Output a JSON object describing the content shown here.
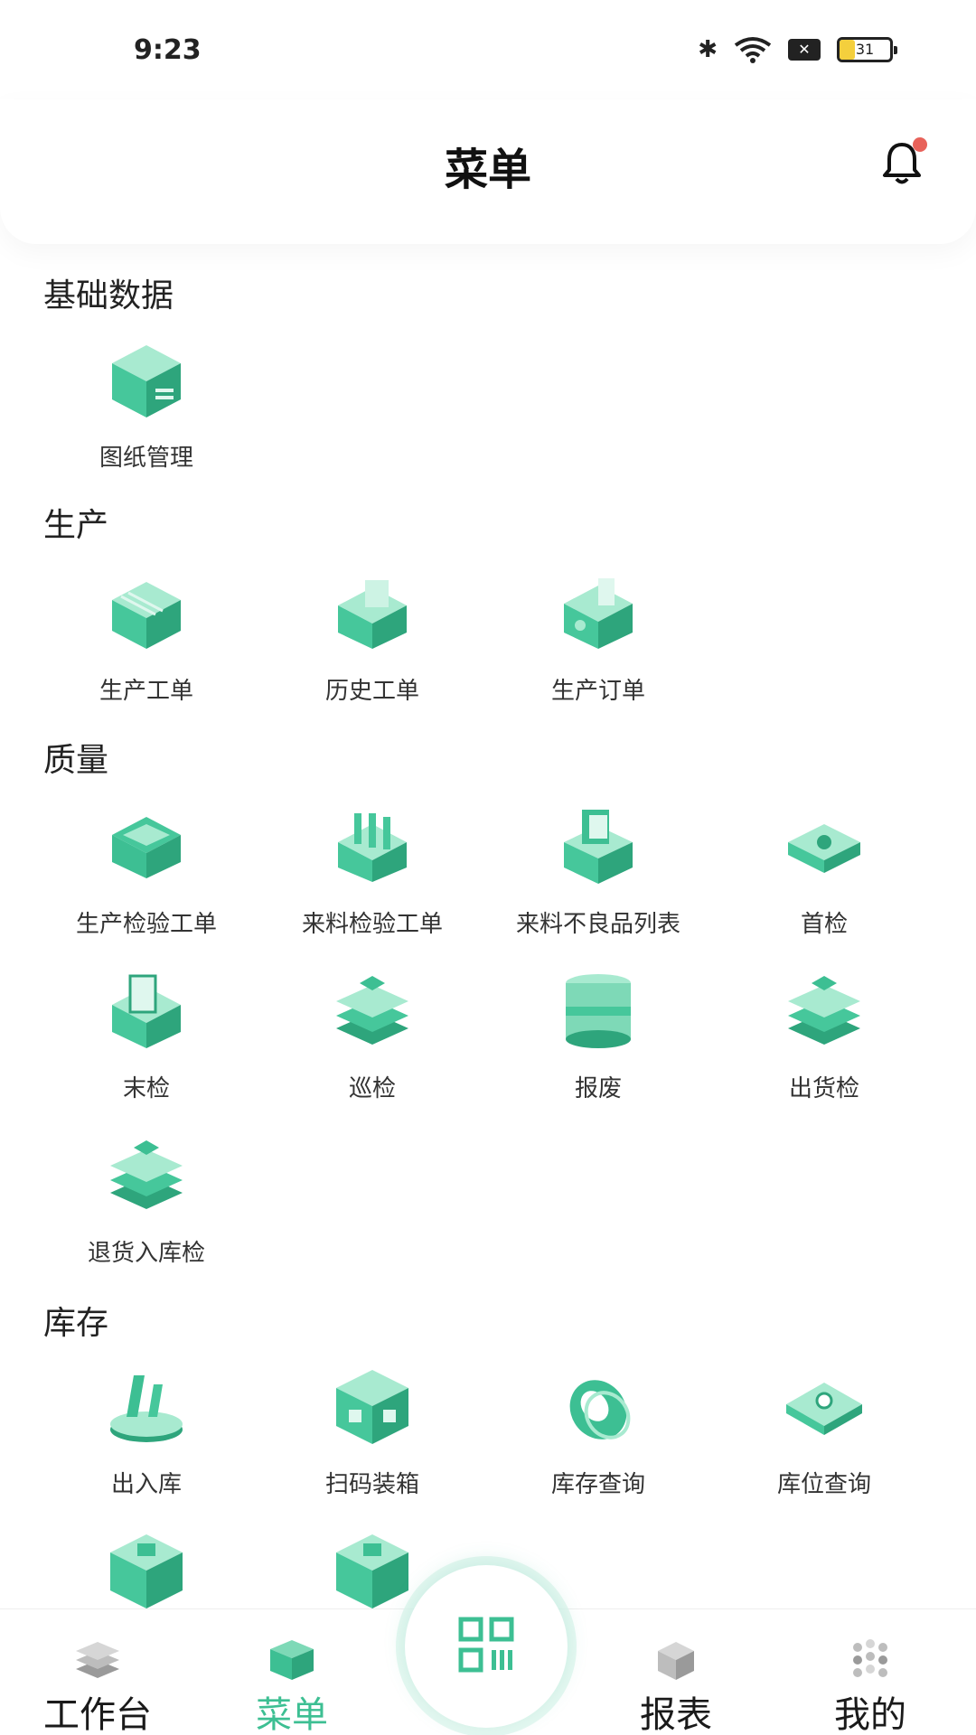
{
  "status": {
    "time": "9:23",
    "battery": "31",
    "battery_level": 0.31
  },
  "header": {
    "title": "菜单"
  },
  "sections": {
    "basic": {
      "title": "基础数据",
      "items": [
        "图纸管理"
      ]
    },
    "production": {
      "title": "生产",
      "items": [
        "生产工单",
        "历史工单",
        "生产订单"
      ]
    },
    "quality": {
      "title": "质量",
      "items": [
        "生产检验工单",
        "来料检验工单",
        "来料不良品列表",
        "首检",
        "末检",
        "巡检",
        "报废",
        "出货检",
        "退货入库检"
      ]
    },
    "inventory": {
      "title": "库存",
      "items": [
        "出入库",
        "扫码装箱",
        "库存查询",
        "库位查询"
      ]
    }
  },
  "bottom_nav": {
    "workbench": "工作台",
    "menu": "菜单",
    "reports": "报表",
    "mine": "我的"
  },
  "colors": {
    "accent": "#3dbf93",
    "icon_light": "#a8ead0",
    "icon_dark": "#2ea57c"
  }
}
